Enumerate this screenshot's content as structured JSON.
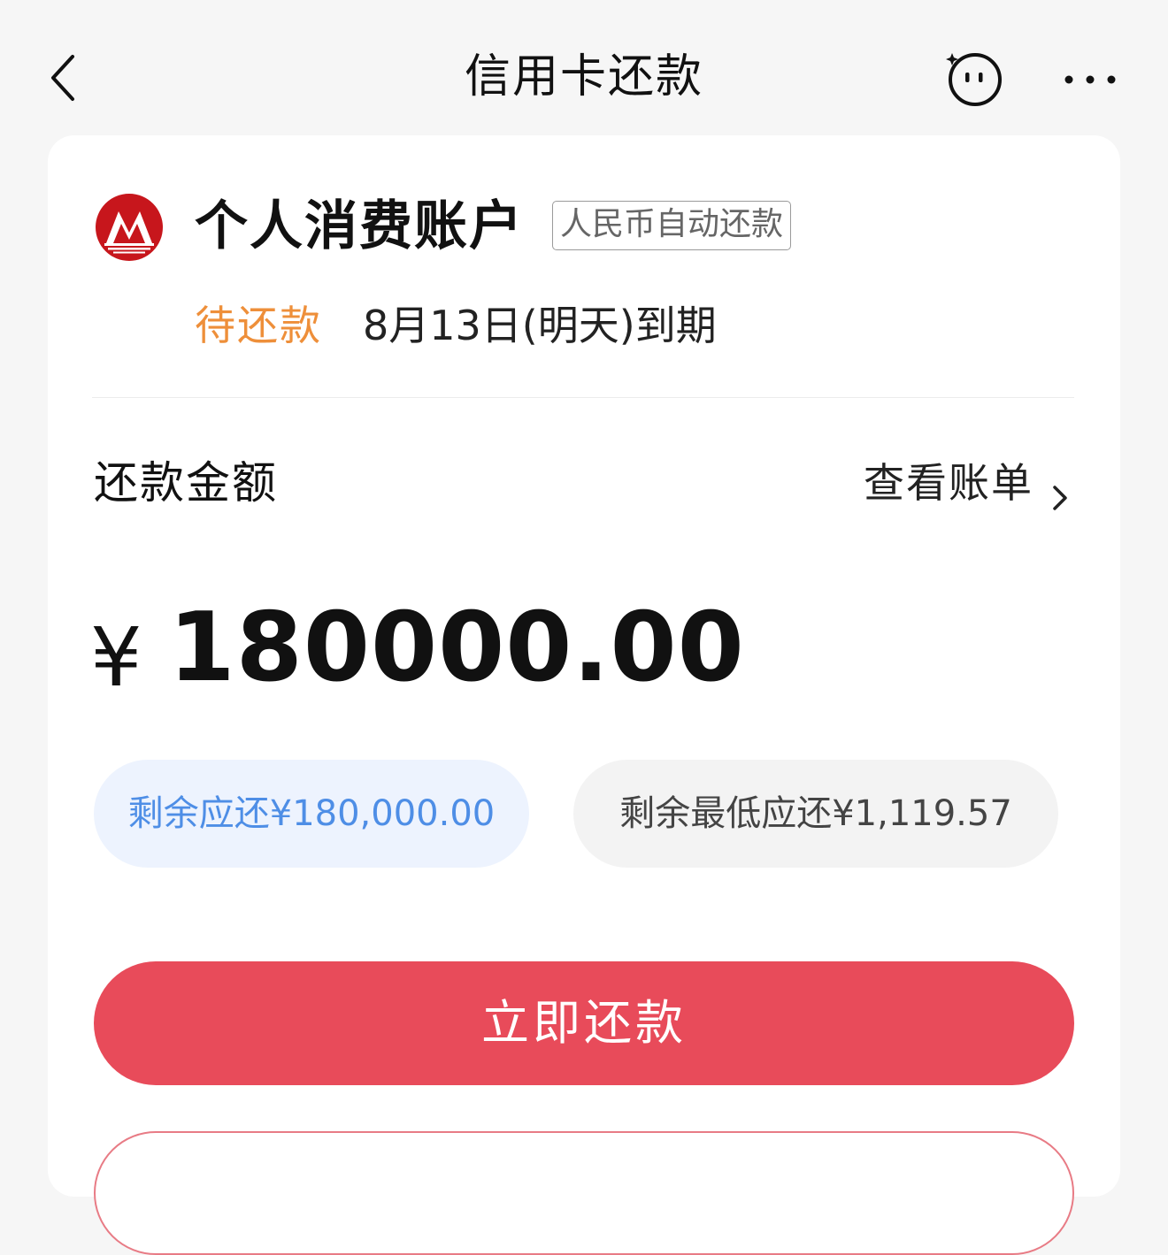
{
  "nav": {
    "title": "信用卡还款",
    "back_icon": "chevron-left-icon",
    "assistant_icon": "assistant-face-icon",
    "more_icon": "more-dots-icon"
  },
  "account": {
    "name": "个人消费账户",
    "auto_repay_tag": "人民币自动还款",
    "status": "待还款",
    "due_text": "8月13日(明天)到期",
    "logo_icon": "bank-logo-icon"
  },
  "repayment": {
    "label": "还款金额",
    "view_bill": "查看账单",
    "currency_symbol": "¥",
    "amount": "180000.00",
    "remaining_due": "剩余应还¥180,000.00",
    "minimum_due": "剩余最低应还¥1,119.57"
  },
  "actions": {
    "pay_now": "立即还款"
  },
  "colors": {
    "accent_red": "#e84b5a",
    "pending_orange": "#ee8f3a",
    "highlight_blue": "#4e8ee6",
    "logo_red": "#c7161c"
  }
}
